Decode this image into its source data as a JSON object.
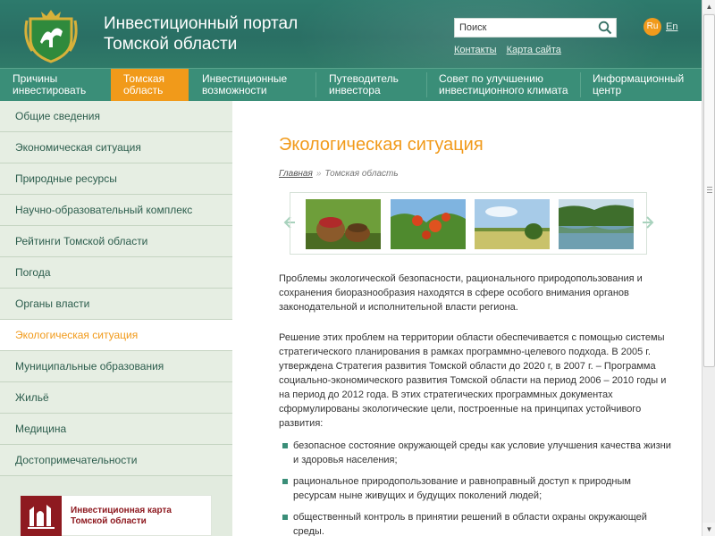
{
  "header": {
    "title_line1": "Инвестиционный портал",
    "title_line2": "Томской области",
    "search_placeholder": "Поиск",
    "links": [
      "Контакты",
      "Карта сайта"
    ],
    "lang_ru": "Ru",
    "lang_en": "En"
  },
  "nav": [
    {
      "line1": "Причины",
      "line2": "инвестировать"
    },
    {
      "line1": "Томская",
      "line2": "область"
    },
    {
      "line1": "Инвестиционные",
      "line2": "возможности"
    },
    {
      "line1": "Путеводитель",
      "line2": "инвестора"
    },
    {
      "line1": "Совет по улучшению",
      "line2": "инвестиционного климата"
    },
    {
      "line1": "Информационный",
      "line2": "центр"
    }
  ],
  "sidebar": {
    "items": [
      "Общие сведения",
      "Экономическая ситуация",
      "Природные ресурсы",
      "Научно-образовательный комплекс",
      "Рейтинги Томской области",
      "Погода",
      "Органы власти",
      "Экологическая ситуация",
      "Муниципальные образования",
      "Жильё",
      "Медицина",
      "Достопримечательности"
    ],
    "active_index": 7,
    "banner_line1": "Инвестиционная карта",
    "banner_line2": "Томской области"
  },
  "content": {
    "page_title": "Экологическая ситуация",
    "breadcrumb_home": "Главная",
    "breadcrumb_sep": "»",
    "breadcrumb_current": "Томская область",
    "para1": "Проблемы экологической безопасности, рационального природопользования и сохранения биоразнообразия находятся в сфере особого внимания органов законодательной и исполнительной власти региона.",
    "para2": "Решение этих проблем на территории области обеспечивается с помощью системы стратегического планирования в рамках программно-целевого подхода. В 2005 г. утверждена Стратегия развития Томской области до 2020 г, в 2007 г. – Программа социально-экономического развития Томской области на период 2006 – 2010 годы и на период до 2012 года. В этих стратегических программных документах сформулированы экологические цели, построенные на принципах устойчивого развития:",
    "bullets": [
      "безопасное состояние окружающей среды как условие улучшения качества жизни и здоровья населения;",
      "рациональное природопользование и равноправный доступ к природным ресурсам ныне живущих и будущих поколений людей;",
      "общественный контроль в принятии решений в области охраны окружающей среды."
    ]
  },
  "colors": {
    "accent": "#f19a1a",
    "header_green": "#2d7a6c",
    "nav_green": "#3a8e78"
  }
}
